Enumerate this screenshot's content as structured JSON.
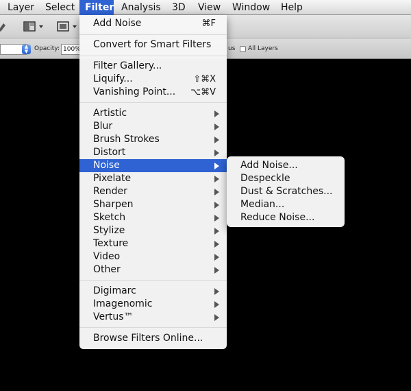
{
  "menubar": {
    "items": [
      "Layer",
      "Select",
      "Filter",
      "Analysis",
      "3D",
      "View",
      "Window",
      "Help"
    ],
    "active": "Filter"
  },
  "options_bar": {
    "opacity_label": "Opacity:",
    "opacity_value": "100%",
    "sample_fragment": "us",
    "all_layers_label": "All Layers"
  },
  "filter_menu": {
    "group1": [
      {
        "label": "Add Noise",
        "shortcut": "⌘F"
      }
    ],
    "group2": [
      {
        "label": "Convert for Smart Filters"
      }
    ],
    "group3": [
      {
        "label": "Filter Gallery..."
      },
      {
        "label": "Liquify...",
        "shortcut": "⇧⌘X"
      },
      {
        "label": "Vanishing Point...",
        "shortcut": "⌥⌘V"
      }
    ],
    "group4": [
      {
        "label": "Artistic"
      },
      {
        "label": "Blur"
      },
      {
        "label": "Brush Strokes"
      },
      {
        "label": "Distort"
      },
      {
        "label": "Noise"
      },
      {
        "label": "Pixelate"
      },
      {
        "label": "Render"
      },
      {
        "label": "Sharpen"
      },
      {
        "label": "Sketch"
      },
      {
        "label": "Stylize"
      },
      {
        "label": "Texture"
      },
      {
        "label": "Video"
      },
      {
        "label": "Other"
      }
    ],
    "group5": [
      {
        "label": "Digimarc"
      },
      {
        "label": "Imagenomic"
      },
      {
        "label": "Vertus™"
      }
    ],
    "group6": [
      {
        "label": "Browse Filters Online..."
      }
    ],
    "highlighted": "Noise"
  },
  "noise_submenu": {
    "items": [
      "Add Noise...",
      "Despeckle",
      "Dust & Scratches...",
      "Median...",
      "Reduce Noise..."
    ]
  },
  "colors": {
    "highlight": "#2f62d3",
    "canvas": "#000000"
  }
}
